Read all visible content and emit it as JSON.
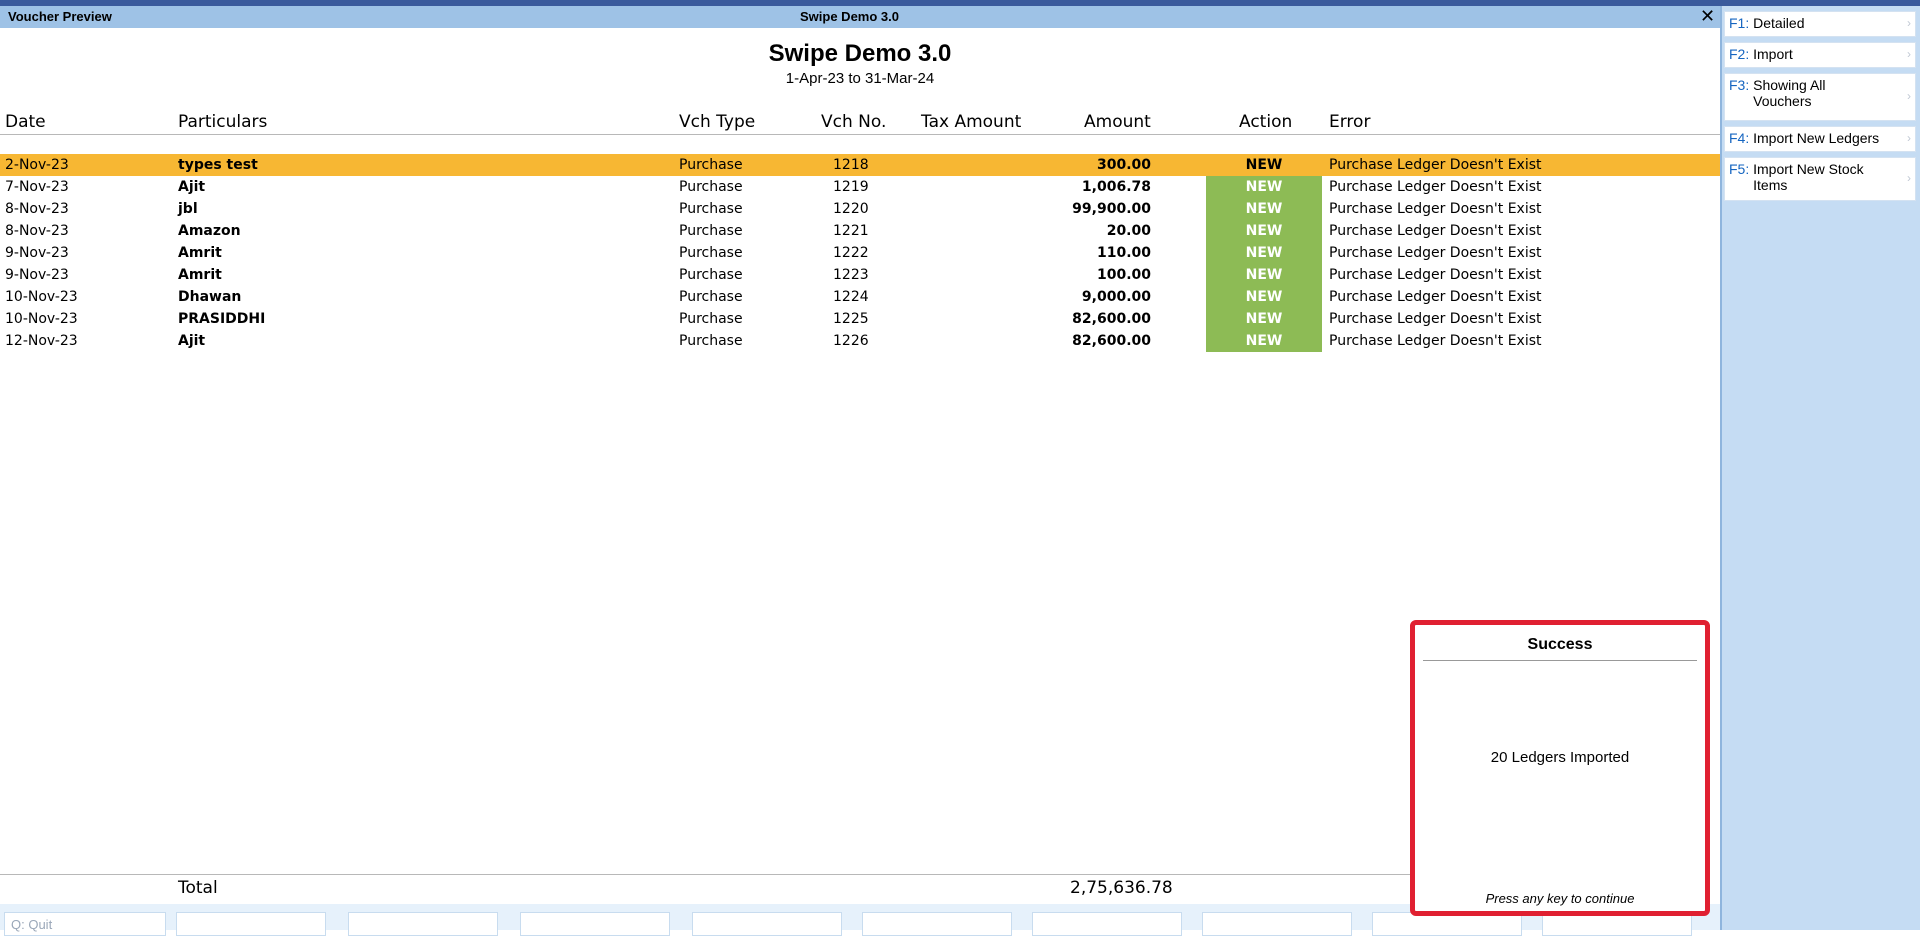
{
  "window": {
    "left_title": "Voucher Preview",
    "center_title": "Swipe Demo 3.0",
    "close": "✕"
  },
  "report": {
    "title": "Swipe Demo 3.0",
    "period": "1-Apr-23 to 31-Mar-24"
  },
  "columns": {
    "date": "Date",
    "particulars": "Particulars",
    "vch_type": "Vch Type",
    "vch_no": "Vch No.",
    "tax_amount": "Tax Amount",
    "amount": "Amount",
    "action": "Action",
    "error": "Error"
  },
  "rows": [
    {
      "date": "2-Nov-23",
      "particulars": "types test",
      "vch_type": "Purchase",
      "vch_no": "1218",
      "tax_amount": "",
      "amount": "300.00",
      "action": "NEW",
      "error": "Purchase Ledger Doesn't Exist"
    },
    {
      "date": "7-Nov-23",
      "particulars": "Ajit",
      "vch_type": "Purchase",
      "vch_no": "1219",
      "tax_amount": "",
      "amount": "1,006.78",
      "action": "NEW",
      "error": "Purchase Ledger Doesn't Exist"
    },
    {
      "date": "8-Nov-23",
      "particulars": "jbl",
      "vch_type": "Purchase",
      "vch_no": "1220",
      "tax_amount": "",
      "amount": "99,900.00",
      "action": "NEW",
      "error": "Purchase Ledger Doesn't Exist"
    },
    {
      "date": "8-Nov-23",
      "particulars": "Amazon",
      "vch_type": "Purchase",
      "vch_no": "1221",
      "tax_amount": "",
      "amount": "20.00",
      "action": "NEW",
      "error": "Purchase Ledger Doesn't Exist"
    },
    {
      "date": "9-Nov-23",
      "particulars": "Amrit",
      "vch_type": "Purchase",
      "vch_no": "1222",
      "tax_amount": "",
      "amount": "110.00",
      "action": "NEW",
      "error": "Purchase Ledger Doesn't Exist"
    },
    {
      "date": "9-Nov-23",
      "particulars": "Amrit",
      "vch_type": "Purchase",
      "vch_no": "1223",
      "tax_amount": "",
      "amount": "100.00",
      "action": "NEW",
      "error": "Purchase Ledger Doesn't Exist"
    },
    {
      "date": "10-Nov-23",
      "particulars": "Dhawan",
      "vch_type": "Purchase",
      "vch_no": "1224",
      "tax_amount": "",
      "amount": "9,000.00",
      "action": "NEW",
      "error": "Purchase Ledger Doesn't Exist"
    },
    {
      "date": "10-Nov-23",
      "particulars": "PRASIDDHI",
      "vch_type": "Purchase",
      "vch_no": "1225",
      "tax_amount": "",
      "amount": "82,600.00",
      "action": "NEW",
      "error": "Purchase Ledger Doesn't Exist"
    },
    {
      "date": "12-Nov-23",
      "particulars": "Ajit",
      "vch_type": "Purchase",
      "vch_no": "1226",
      "tax_amount": "",
      "amount": "82,600.00",
      "action": "NEW",
      "error": "Purchase Ledger Doesn't Exist"
    }
  ],
  "total": {
    "label": "Total",
    "amount": "2,75,636.78"
  },
  "right_panel": [
    {
      "key": "F1",
      "label": "Detailed"
    },
    {
      "key": "F2",
      "label": "Import"
    },
    {
      "key": "F3",
      "label": "Showing All Vouchers"
    },
    {
      "key": "F4",
      "label": "Import New Ledgers"
    },
    {
      "key": "F5",
      "label": "Import New Stock Items"
    }
  ],
  "bottom_bar": {
    "first_button": "Q: Quit"
  },
  "popup": {
    "title": "Success",
    "message": "20 Ledgers Imported",
    "footer": "Press any key to continue"
  },
  "colors": {
    "selected_row": "#f7b733",
    "action_badge": "#8dbb55",
    "popup_border": "#e02031",
    "title_bar": "#9ec2e6"
  }
}
